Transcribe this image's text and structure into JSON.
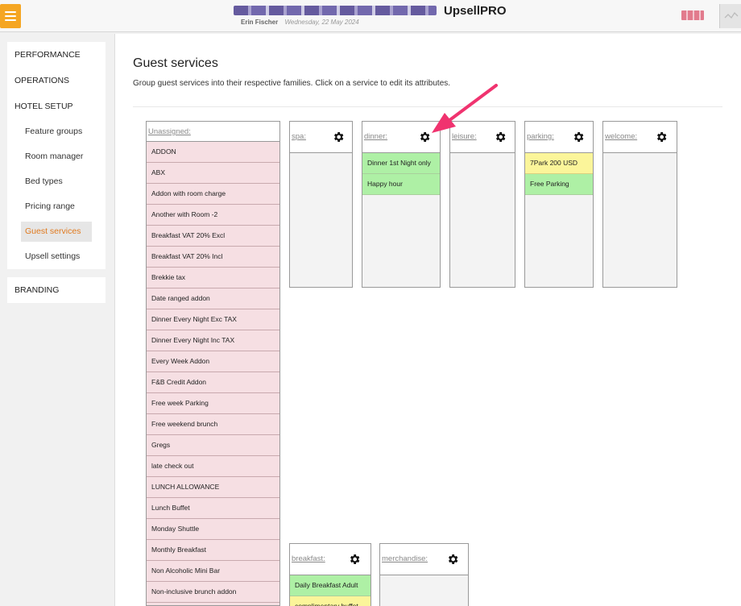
{
  "header": {
    "app_name": "UpsellPRO",
    "user": "Erin Fischer",
    "date": "Wednesday, 22 May 2024"
  },
  "sidebar": {
    "sections": [
      {
        "label": "PERFORMANCE"
      },
      {
        "label": "OPERATIONS"
      },
      {
        "label": "HOTEL SETUP"
      },
      {
        "label": "BRANDING"
      }
    ],
    "hotel_setup_items": [
      {
        "label": "Feature groups"
      },
      {
        "label": "Room manager"
      },
      {
        "label": "Bed types"
      },
      {
        "label": "Pricing range"
      },
      {
        "label": "Guest services",
        "active": true
      },
      {
        "label": "Upsell settings"
      }
    ]
  },
  "main": {
    "title": "Guest services",
    "description": "Group guest services into their respective families. Click on a service to edit its attributes.",
    "unassigned": {
      "label": "Unassigned:",
      "items": [
        "ADDON",
        "ABX",
        "Addon with room charge",
        "Another with Room -2",
        "Breakfast VAT 20% Excl",
        "Breakfast VAT 20% Incl",
        "Brekkie tax",
        "Date ranged addon",
        "Dinner Every Night Exc TAX",
        "Dinner Every Night Inc TAX",
        "Every Week Addon",
        "F&B Credit Addon",
        "Free week Parking",
        "Free weekend brunch",
        "Gregs",
        "late check out",
        "LUNCH ALLOWANCE",
        "Lunch Buffet",
        "Monday Shuttle",
        "Monthly Breakfast",
        "Non Alcoholic Mini Bar",
        "Non-inclusive brunch addon"
      ]
    },
    "families": [
      {
        "name": "spa:",
        "services": []
      },
      {
        "name": "dinner:",
        "services": [
          {
            "label": "Dinner 1st Night only",
            "color": "#aef0a5"
          },
          {
            "label": "Happy hour",
            "color": "#aef0a5"
          }
        ]
      },
      {
        "name": "leisure:",
        "services": []
      },
      {
        "name": "parking:",
        "services": [
          {
            "label": "7Park 200 USD",
            "color": "#fbf59a"
          },
          {
            "label": "Free Parking",
            "color": "#aef0a5"
          }
        ]
      },
      {
        "name": "welcome:",
        "services": []
      },
      {
        "name": "breakfast:",
        "services": [
          {
            "label": "Daily Breakfast Adult",
            "color": "#aef0a5"
          },
          {
            "label": "complimentary buffet",
            "color": "#fbf59a"
          }
        ]
      },
      {
        "name": "merchandise:",
        "services": []
      }
    ]
  },
  "colors": {
    "accent": "#f5a623",
    "active_nav": "#e07a1f",
    "unassigned_bg": "#f6dfe3",
    "annotation_arrow": "#f0336f"
  }
}
